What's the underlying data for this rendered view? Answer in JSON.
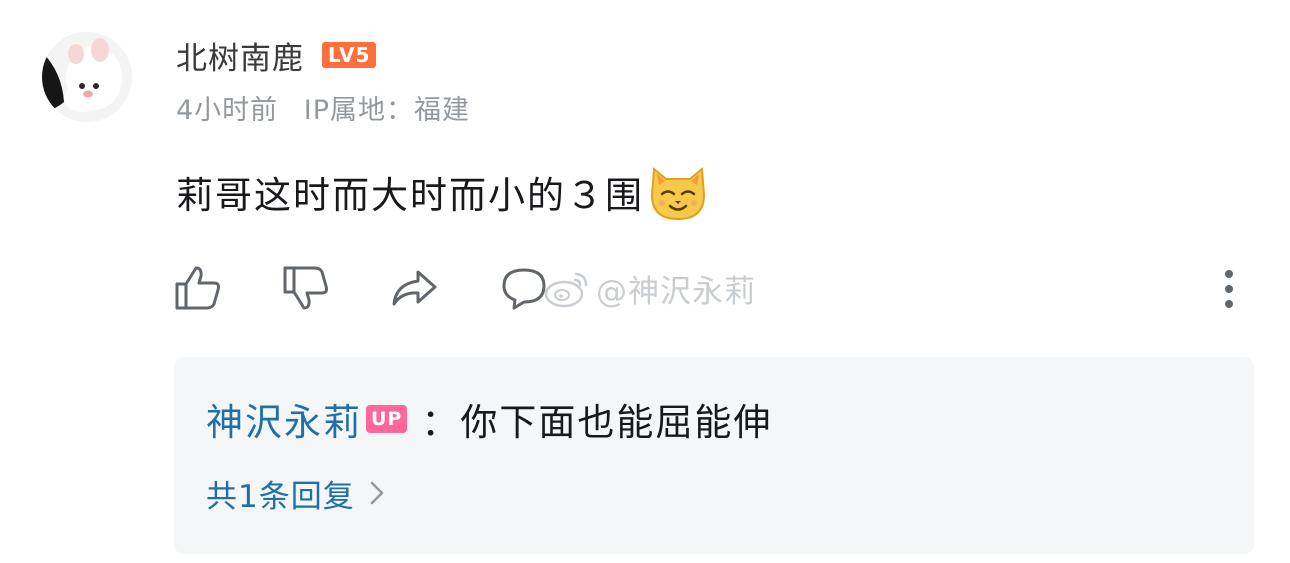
{
  "comment": {
    "username": "北树南鹿",
    "level_badge": "LV5",
    "time": "4小时前",
    "ip_location": "IP属地：福建",
    "text": "莉哥这时而大时而小的３围",
    "emoji": "cat-smile-emoji"
  },
  "actions": {
    "like_icon": "thumbs-up-icon",
    "dislike_icon": "thumbs-down-icon",
    "share_icon": "share-icon",
    "reply_icon": "comment-icon",
    "more_icon": "more-vertical-icon"
  },
  "watermark": {
    "text": "@神沢永莉",
    "icon": "weibo-logo"
  },
  "reply": {
    "author": "神沢永莉",
    "up_badge": "UP",
    "colon": "：",
    "text": "你下面也能屈能伸",
    "count_label": "共1条回复"
  },
  "colors": {
    "level_badge": "#ff6f3c",
    "up_badge": "#ff6699",
    "link_blue": "#1f6fa9",
    "meta_gray": "#9499a0",
    "reply_bg": "#f5f6f7"
  }
}
